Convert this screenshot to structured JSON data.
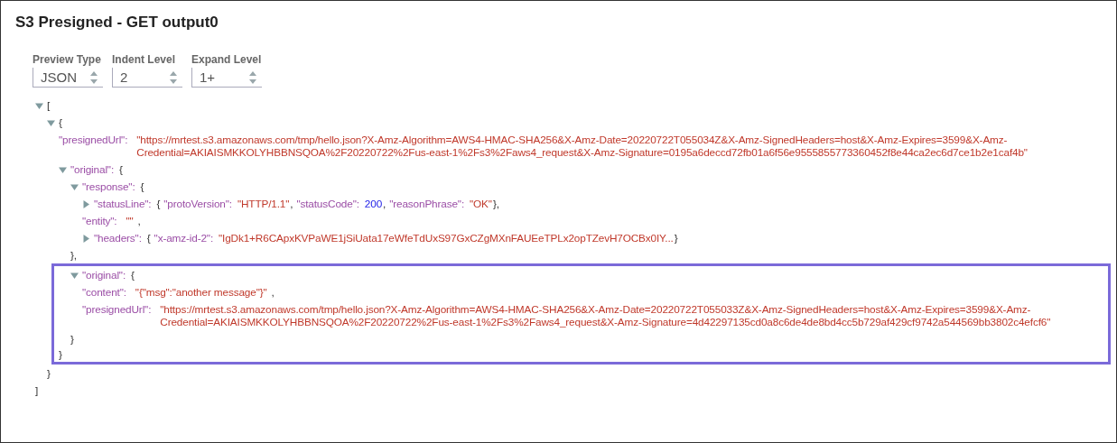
{
  "title": "S3 Presigned - GET output0",
  "controls": [
    {
      "label": "Preview Type",
      "value": "JSON"
    },
    {
      "label": "Indent Level",
      "value": "2"
    },
    {
      "label": "Expand Level",
      "value": "1+"
    }
  ],
  "tree": [
    {
      "kind": "container",
      "open": "[",
      "close": "]",
      "expanded": true,
      "children": [
        {
          "kind": "container",
          "open": "{",
          "close": "}",
          "expanded": true,
          "children": [
            {
              "kind": "leaf",
              "key": "\"presignedUrl\":",
              "value": "\"https://mrtest.s3.amazonaws.com/tmp/hello.json?X-Amz-Algorithm=AWS4-HMAC-SHA256&X-Amz-Date=20220722T055034Z&X-Amz-SignedHeaders=host&X-Amz-Expires=3599&X-Amz-Credential=AKIAISMKKOLYHBBNSQOA%2F20220722%2Fus-east-1%2Fs3%2Faws4_request&X-Amz-Signature=0195a6deccd72fb01a6f56e9555855773360452f8e44ca2ec6d7ce1b2e1caf4b\""
            },
            {
              "kind": "container",
              "key": "\"original\":",
              "open": "{",
              "close": "}",
              "expanded": true,
              "close_highlighted": true,
              "children": [
                {
                  "kind": "container",
                  "key": "\"response\":",
                  "open": "{",
                  "close": "},",
                  "expanded": true,
                  "children": [
                    {
                      "kind": "container",
                      "key": "\"statusLine\":",
                      "expanded": false,
                      "preview": [
                        {
                          "kind": "punct",
                          "text": "{"
                        },
                        {
                          "kind": "key",
                          "text": "\"protoVersion\":"
                        },
                        {
                          "kind": "string",
                          "text": "\"HTTP/1.1\""
                        },
                        {
                          "kind": "punct",
                          "text": ","
                        },
                        {
                          "kind": "key",
                          "text": "\"statusCode\":"
                        },
                        {
                          "kind": "number",
                          "text": "200"
                        },
                        {
                          "kind": "punct",
                          "text": ","
                        },
                        {
                          "kind": "key",
                          "text": "\"reasonPhrase\":"
                        },
                        {
                          "kind": "string",
                          "text": "\"OK\""
                        },
                        {
                          "kind": "punct",
                          "text": "},"
                        }
                      ]
                    },
                    {
                      "kind": "leaf",
                      "key": "\"entity\":",
                      "value": "\"\"",
                      "trail": ","
                    },
                    {
                      "kind": "container",
                      "key": "\"headers\":",
                      "expanded": false,
                      "preview": [
                        {
                          "kind": "punct",
                          "text": "{"
                        },
                        {
                          "kind": "key",
                          "text": "\"x-amz-id-2\":"
                        },
                        {
                          "kind": "string",
                          "text": "\"IgDk1+R6CApxKVPaWE1jSiUata17eWfeTdUxS97GxCZgMXnFAUEeTPLx2opTZevH7OCBx0IY..."
                        },
                        {
                          "kind": "punct",
                          "text": "}"
                        }
                      ]
                    }
                  ]
                },
                {
                  "kind": "container",
                  "key": "\"original\":",
                  "open": "{",
                  "close": "}",
                  "expanded": true,
                  "highlighted": true,
                  "children": [
                    {
                      "kind": "leaf",
                      "key": "\"content\":",
                      "value": "\"{\"msg\":\"another message\"}\"",
                      "trail": ","
                    },
                    {
                      "kind": "leaf",
                      "key": "\"presignedUrl\":",
                      "value": "\"https://mrtest.s3.amazonaws.com/tmp/hello.json?X-Amz-Algorithm=AWS4-HMAC-SHA256&X-Amz-Date=20220722T055033Z&X-Amz-SignedHeaders=host&X-Amz-Expires=3599&X-Amz-Credential=AKIAISMKKOLYHBBNSQOA%2F20220722%2Fus-east-1%2Fs3%2Faws4_request&X-Amz-Signature=4d42297135cd0a8c6de4de8bd4cc5b729af429cf9742a544569bb3802c4efcf6\""
                    }
                  ]
                }
              ]
            }
          ]
        }
      ]
    }
  ]
}
